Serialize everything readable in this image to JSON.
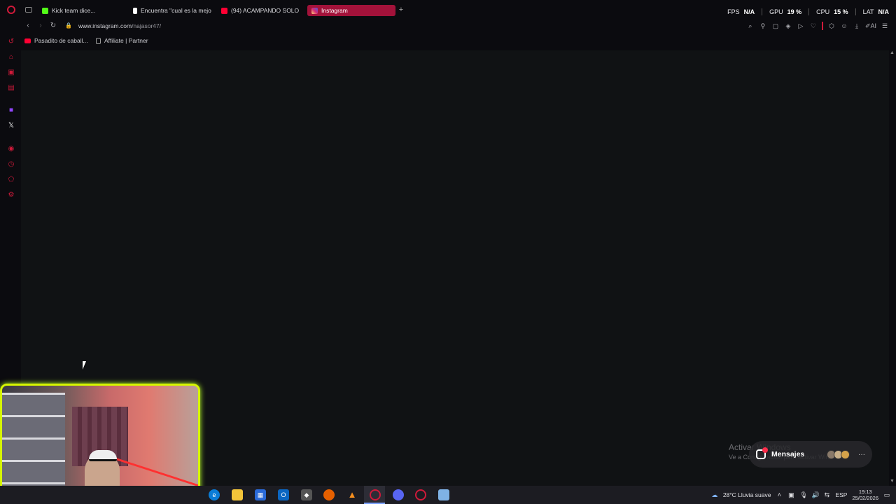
{
  "browser": {
    "tabs": [
      {
        "label": "Kick team dice...",
        "favicon_color": "#53fc18",
        "active": false
      },
      {
        "label": "Encuentra \"cual es la mejo",
        "favicon_color": "#ffffff",
        "active": false
      },
      {
        "label": "(94) ACAMPANDO SOLO",
        "favicon_color": "#ff0033",
        "active": false
      },
      {
        "label": "Instagram",
        "favicon_color": "#e1306c",
        "active": true
      }
    ],
    "stats": {
      "fps_label": "FPS",
      "fps_value": "N/A",
      "gpu_label": "GPU",
      "gpu_value": "19 %",
      "cpu_label": "CPU",
      "cpu_value": "15 %",
      "lat_label": "LAT",
      "lat_value": "N/A"
    },
    "url_host": "www.instagram.com",
    "url_path": "/najasor47/",
    "toolbar_ai": "AI",
    "bookmarks": [
      {
        "label": "Pasadito de caball...",
        "icon": "youtube-icon",
        "color": "#ff0033"
      },
      {
        "label": "Affiliate | Partner",
        "icon": "page-icon",
        "color": "#888888"
      }
    ],
    "accent": "#d01a3a"
  },
  "overlay": {
    "activate_title": "Activar Windows",
    "activate_sub": "Ve a Configuración para activar Windows.",
    "messages_label": "Mensajes",
    "messages_more": "···"
  },
  "taskbar": {
    "weather": "28°C  Lluvia suave",
    "language": "ESP",
    "time": "19:13",
    "date": "25/02/2026"
  }
}
